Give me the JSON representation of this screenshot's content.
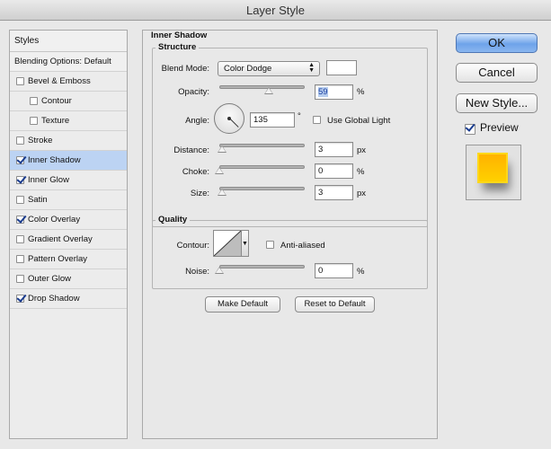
{
  "window": {
    "title": "Layer Style"
  },
  "styles_panel": {
    "header": "Styles",
    "blending_options": "Blending Options: Default",
    "items": [
      {
        "label": "Bevel & Emboss",
        "checked": false,
        "indent": false,
        "selected": false
      },
      {
        "label": "Contour",
        "checked": false,
        "indent": true,
        "selected": false
      },
      {
        "label": "Texture",
        "checked": false,
        "indent": true,
        "selected": false
      },
      {
        "label": "Stroke",
        "checked": false,
        "indent": false,
        "selected": false
      },
      {
        "label": "Inner Shadow",
        "checked": true,
        "indent": false,
        "selected": true
      },
      {
        "label": "Inner Glow",
        "checked": true,
        "indent": false,
        "selected": false
      },
      {
        "label": "Satin",
        "checked": false,
        "indent": false,
        "selected": false
      },
      {
        "label": "Color Overlay",
        "checked": true,
        "indent": false,
        "selected": false
      },
      {
        "label": "Gradient Overlay",
        "checked": false,
        "indent": false,
        "selected": false
      },
      {
        "label": "Pattern Overlay",
        "checked": false,
        "indent": false,
        "selected": false
      },
      {
        "label": "Outer Glow",
        "checked": false,
        "indent": false,
        "selected": false
      },
      {
        "label": "Drop Shadow",
        "checked": true,
        "indent": false,
        "selected": false
      }
    ]
  },
  "inner_shadow": {
    "title": "Inner Shadow",
    "structure": {
      "title": "Structure",
      "blend_mode_label": "Blend Mode:",
      "blend_mode_value": "Color Dodge",
      "blend_color": "#ffffff",
      "opacity_label": "Opacity:",
      "opacity_value": "59",
      "opacity_unit": "%",
      "angle_label": "Angle:",
      "angle_value": "135",
      "angle_unit": "°",
      "use_global_light_label": "Use Global Light",
      "use_global_light_checked": false,
      "distance_label": "Distance:",
      "distance_value": "3",
      "distance_unit": "px",
      "choke_label": "Choke:",
      "choke_value": "0",
      "choke_unit": "%",
      "size_label": "Size:",
      "size_value": "3",
      "size_unit": "px"
    },
    "quality": {
      "title": "Quality",
      "contour_label": "Contour:",
      "anti_aliased_label": "Anti-aliased",
      "anti_aliased_checked": false,
      "noise_label": "Noise:",
      "noise_value": "0",
      "noise_unit": "%"
    },
    "make_default_label": "Make Default",
    "reset_default_label": "Reset to Default"
  },
  "actions": {
    "ok_label": "OK",
    "cancel_label": "Cancel",
    "new_style_label": "New Style...",
    "preview_label": "Preview",
    "preview_checked": true
  },
  "colors": {
    "accent": "#6ea3ea",
    "selected_row": "#bcd3f3",
    "preview_fill": "#ffc000"
  }
}
